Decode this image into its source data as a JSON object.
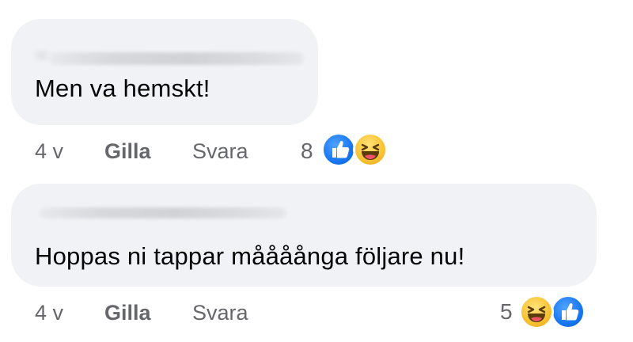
{
  "comments": [
    {
      "text": "Men va hemskt!",
      "time": "4 v",
      "like_label": "Gilla",
      "reply_label": "Svara",
      "reaction_count": "8",
      "reactions": [
        "like-icon",
        "haha-icon"
      ]
    },
    {
      "text": "Hoppas ni tappar måååånga följare nu!",
      "time": "4 v",
      "like_label": "Gilla",
      "reply_label": "Svara",
      "reaction_count": "5",
      "reactions": [
        "haha-icon",
        "like-icon"
      ]
    }
  ],
  "colors": {
    "bubble_bg": "#f0f2f5",
    "meta_text": "#65676b",
    "like_blue": "#1877f2",
    "haha_yellow": "#f7c232"
  }
}
